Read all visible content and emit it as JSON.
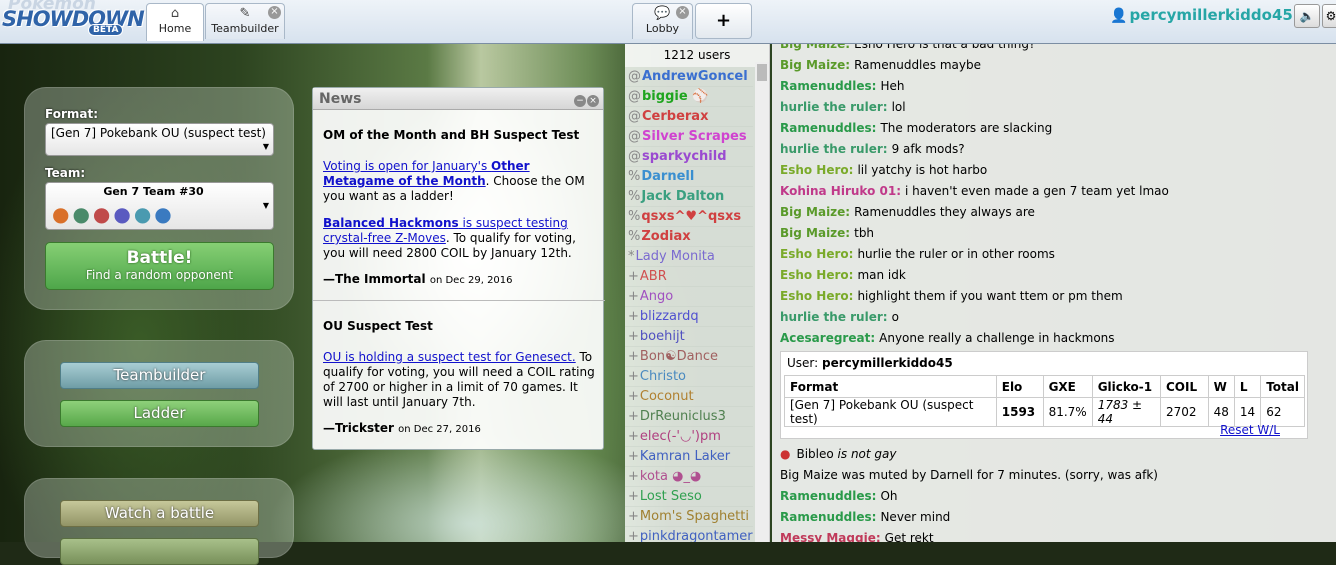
{
  "header": {
    "logo_top": "Pokémon",
    "logo_main": "SHOWDOWN",
    "logo_badge": "BETA",
    "tabs": [
      {
        "label": "Home",
        "icon": "home-icon"
      },
      {
        "label": "Teambuilder",
        "icon": "edit-icon"
      },
      {
        "label": "Lobby",
        "icon": "chat-bubble-icon"
      }
    ],
    "plus": "+",
    "username": "percymillerkiddo45"
  },
  "home": {
    "format_label": "Format:",
    "format_value": "[Gen 7] Pokebank OU (suspect test)",
    "team_label": "Team:",
    "team_value": "Gen 7 Team #30",
    "battle_title": "Battle!",
    "battle_sub": "Find a random opponent",
    "teambuilder": "Teambuilder",
    "ladder": "Ladder",
    "watch": "Watch a battle"
  },
  "news": {
    "title": "News",
    "item1": {
      "heading": "OM of the Month and BH Suspect Test",
      "p1_link1": "Voting is open for January's ",
      "p1_link2": "Other Metagame of the Month",
      "p1_text": ". Choose the OM you want as a ladder!",
      "p2_link1": "Balanced Hackmons",
      "p2_link2": " is suspect testing crystal-free Z-Moves",
      "p2_text": ". To qualify for voting, you will need 2800 COIL by January 12th.",
      "sig": "—The Immortal",
      "date": "on Dec 29, 2016"
    },
    "item2": {
      "heading": "OU Suspect Test",
      "p1_link": "OU is holding a suspect test for Genesect.",
      "p1_text": " To qualify for voting, you will need a COIL rating of 2700 or higher in a limit of 70 games. It will last until January 7th.",
      "sig": "—Trickster",
      "date": "on Dec 27, 2016"
    }
  },
  "userlist": {
    "count": "1212 users",
    "users": [
      {
        "group": "@",
        "name": "AndrewGoncel >",
        "color": "#3a6fd0",
        "bold": true
      },
      {
        "group": "@",
        "name": "biggie ⚾",
        "color": "#1fa51f",
        "bold": true
      },
      {
        "group": "@",
        "name": "Cerberax",
        "color": "#d04040",
        "bold": true
      },
      {
        "group": "@",
        "name": "Silver Scrapes",
        "color": "#d043d0",
        "bold": true
      },
      {
        "group": "@",
        "name": "sparkychild",
        "color": "#9a4ad0",
        "bold": true
      },
      {
        "group": "%",
        "name": "Darnell",
        "color": "#3a8fd0",
        "bold": true
      },
      {
        "group": "%",
        "name": "Jack Dalton",
        "color": "#3aa080",
        "bold": true
      },
      {
        "group": "%",
        "name": "qsxs^♥^qsxs",
        "color": "#d04040",
        "bold": true
      },
      {
        "group": "%",
        "name": "Zodiax",
        "color": "#d04040",
        "bold": true
      },
      {
        "group": "*",
        "name": "Lady Monita",
        "color": "#7a6ad0",
        "bold": false
      },
      {
        "group": "+",
        "name": "ABR",
        "color": "#d05050",
        "bold": false
      },
      {
        "group": "+",
        "name": "Ango",
        "color": "#a050c0",
        "bold": false
      },
      {
        "group": "+",
        "name": "blizzardq",
        "color": "#5050d0",
        "bold": false
      },
      {
        "group": "+",
        "name": "boehijt",
        "color": "#5050c0",
        "bold": false
      },
      {
        "group": "+",
        "name": "Bon☯Dance",
        "color": "#a06060",
        "bold": false
      },
      {
        "group": "+",
        "name": "Christo",
        "color": "#4a8ac0",
        "bold": false
      },
      {
        "group": "+",
        "name": "Coconut",
        "color": "#b08030",
        "bold": false
      },
      {
        "group": "+",
        "name": "DrReuniclus3",
        "color": "#508050",
        "bold": false
      },
      {
        "group": "+",
        "name": "elec(-'◡')pm",
        "color": "#b04080",
        "bold": false
      },
      {
        "group": "+",
        "name": "Kamran Laker",
        "color": "#4060c0",
        "bold": false
      },
      {
        "group": "+",
        "name": "kota ◕_◕",
        "color": "#b05090",
        "bold": false
      },
      {
        "group": "+",
        "name": "Lost Seso",
        "color": "#30a050",
        "bold": false
      },
      {
        "group": "+",
        "name": "Mom's Spaghetti",
        "color": "#a08030",
        "bold": false
      },
      {
        "group": "+",
        "name": "pinkdragontamer",
        "color": "#4060c0",
        "bold": false
      }
    ]
  },
  "chat": {
    "lines": [
      {
        "user": "Big Maize:",
        "color": "#5a9a2a",
        "msg": "Esho Hero is that a bad thing?"
      },
      {
        "user": "Big Maize:",
        "color": "#5a9a2a",
        "msg": "Ramenuddles maybe"
      },
      {
        "user": "Ramenuddles:",
        "color": "#2a9a4a",
        "msg": "Heh"
      },
      {
        "user": "hurlie the ruler:",
        "color": "#3a9a6a",
        "msg": "lol"
      },
      {
        "user": "Ramenuddles:",
        "color": "#2a9a4a",
        "msg": "The moderators are slacking"
      },
      {
        "user": "hurlie the ruler:",
        "color": "#3a9a6a",
        "msg": "9 afk mods?"
      },
      {
        "user": "Esho Hero:",
        "color": "#7aaa2a",
        "msg": "lil yatchy is hot harbo"
      },
      {
        "user": "Kohina Hiruko 01:",
        "color": "#c03a8a",
        "msg": "i haven't even made a gen 7 team yet lmao"
      },
      {
        "user": "Big Maize:",
        "color": "#5a9a2a",
        "msg": "Ramenuddles they always are"
      },
      {
        "user": "Big Maize:",
        "color": "#5a9a2a",
        "msg": "tbh"
      },
      {
        "user": "Esho Hero:",
        "color": "#7aaa2a",
        "msg": "hurlie the ruler or in other rooms"
      },
      {
        "user": "Esho Hero:",
        "color": "#7aaa2a",
        "msg": "man idk"
      },
      {
        "user": "Esho Hero:",
        "color": "#7aaa2a",
        "msg": "highlight them if you want ttem or pm them"
      },
      {
        "user": "hurlie the ruler:",
        "color": "#3a9a6a",
        "msg": "o"
      },
      {
        "user": "Acesaregreat:",
        "color": "#2a9a4a",
        "msg": "Anyone really a challenge in hackmons"
      }
    ],
    "rank": {
      "user_label": "User:",
      "user": "percymillerkiddo45",
      "headers": [
        "Format",
        "Elo",
        "GXE",
        "Glicko-1",
        "COIL",
        "W",
        "L",
        "Total"
      ],
      "row": [
        "[Gen 7] Pokebank OU (suspect test)",
        "1593",
        "81.7%",
        "1783 ± 44",
        "2702",
        "48",
        "14",
        "62"
      ],
      "reset": "Reset W/L"
    },
    "after": [
      {
        "type": "raw",
        "bullet": "●",
        "a": "Bibleo ",
        "b": "is not gay"
      },
      {
        "type": "notice",
        "text": "Big Maize was muted by Darnell for 7 minutes. (sorry, was afk)"
      },
      {
        "user": "Ramenuddles:",
        "color": "#2a9a4a",
        "msg": "Oh"
      },
      {
        "user": "Ramenuddles:",
        "color": "#2a9a4a",
        "msg": "Never mind"
      },
      {
        "user": "Messy Maggie:",
        "color": "#c03a5a",
        "msg": "Get rekt"
      }
    ]
  }
}
